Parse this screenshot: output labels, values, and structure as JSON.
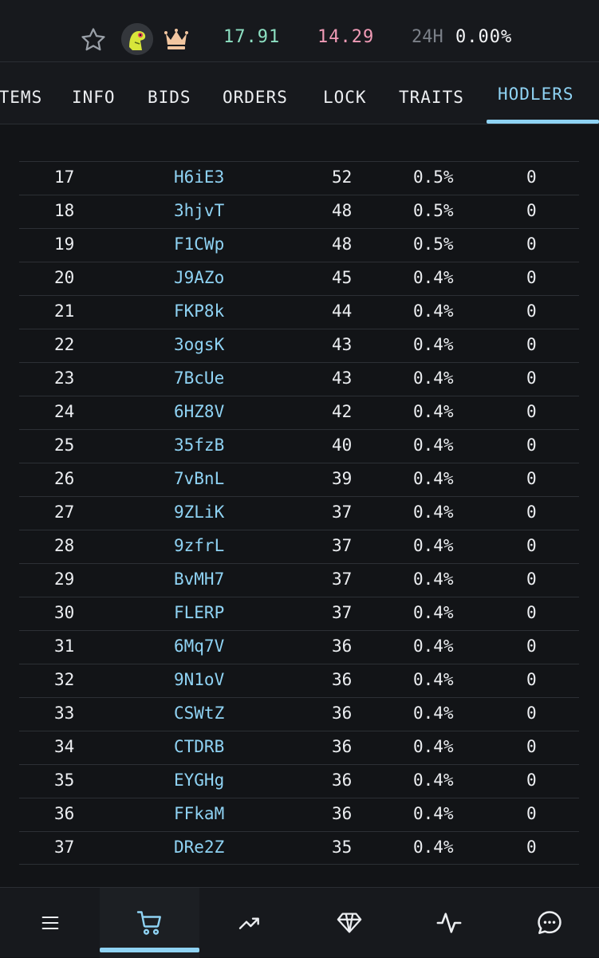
{
  "stats": {
    "floor_price": "17.91",
    "ask_price": "14.29",
    "change_label": "24H",
    "change_value": "0.00%"
  },
  "tabs": [
    {
      "label": "ITEMS"
    },
    {
      "label": "INFO"
    },
    {
      "label": "BIDS"
    },
    {
      "label": "ORDERS"
    },
    {
      "label": "LOCK"
    },
    {
      "label": "TRAITS"
    },
    {
      "label": "HODLERS",
      "active": true
    }
  ],
  "holders": [
    {
      "rank": "17",
      "address": "H6iE3",
      "count": "52",
      "percent": "0.5%",
      "listed": "0"
    },
    {
      "rank": "18",
      "address": "3hjvT",
      "count": "48",
      "percent": "0.5%",
      "listed": "0"
    },
    {
      "rank": "19",
      "address": "F1CWp",
      "count": "48",
      "percent": "0.5%",
      "listed": "0"
    },
    {
      "rank": "20",
      "address": "J9AZo",
      "count": "45",
      "percent": "0.4%",
      "listed": "0"
    },
    {
      "rank": "21",
      "address": "FKP8k",
      "count": "44",
      "percent": "0.4%",
      "listed": "0"
    },
    {
      "rank": "22",
      "address": "3ogsK",
      "count": "43",
      "percent": "0.4%",
      "listed": "0"
    },
    {
      "rank": "23",
      "address": "7BcUe",
      "count": "43",
      "percent": "0.4%",
      "listed": "0"
    },
    {
      "rank": "24",
      "address": "6HZ8V",
      "count": "42",
      "percent": "0.4%",
      "listed": "0"
    },
    {
      "rank": "25",
      "address": "35fzB",
      "count": "40",
      "percent": "0.4%",
      "listed": "0"
    },
    {
      "rank": "26",
      "address": "7vBnL",
      "count": "39",
      "percent": "0.4%",
      "listed": "0"
    },
    {
      "rank": "27",
      "address": "9ZLiK",
      "count": "37",
      "percent": "0.4%",
      "listed": "0"
    },
    {
      "rank": "28",
      "address": "9zfrL",
      "count": "37",
      "percent": "0.4%",
      "listed": "0"
    },
    {
      "rank": "29",
      "address": "BvMH7",
      "count": "37",
      "percent": "0.4%",
      "listed": "0"
    },
    {
      "rank": "30",
      "address": "FLERP",
      "count": "37",
      "percent": "0.4%",
      "listed": "0"
    },
    {
      "rank": "31",
      "address": "6Mq7V",
      "count": "36",
      "percent": "0.4%",
      "listed": "0"
    },
    {
      "rank": "32",
      "address": "9N1oV",
      "count": "36",
      "percent": "0.4%",
      "listed": "0"
    },
    {
      "rank": "33",
      "address": "CSWtZ",
      "count": "36",
      "percent": "0.4%",
      "listed": "0"
    },
    {
      "rank": "34",
      "address": "CTDRB",
      "count": "36",
      "percent": "0.4%",
      "listed": "0"
    },
    {
      "rank": "35",
      "address": "EYGHg",
      "count": "36",
      "percent": "0.4%",
      "listed": "0"
    },
    {
      "rank": "36",
      "address": "FFkaM",
      "count": "36",
      "percent": "0.4%",
      "listed": "0"
    },
    {
      "rank": "37",
      "address": "DRe2Z",
      "count": "35",
      "percent": "0.4%",
      "listed": "0"
    }
  ],
  "bottom_nav": [
    {
      "icon": "menu-icon"
    },
    {
      "icon": "cart-icon",
      "active": true
    },
    {
      "icon": "trending-up-icon"
    },
    {
      "icon": "diamond-icon"
    },
    {
      "icon": "activity-icon"
    },
    {
      "icon": "chat-icon"
    }
  ],
  "colors": {
    "accent": "#8fd3f4",
    "floor": "#8de0c2",
    "ask": "#f09bb6",
    "background": "#121417"
  }
}
